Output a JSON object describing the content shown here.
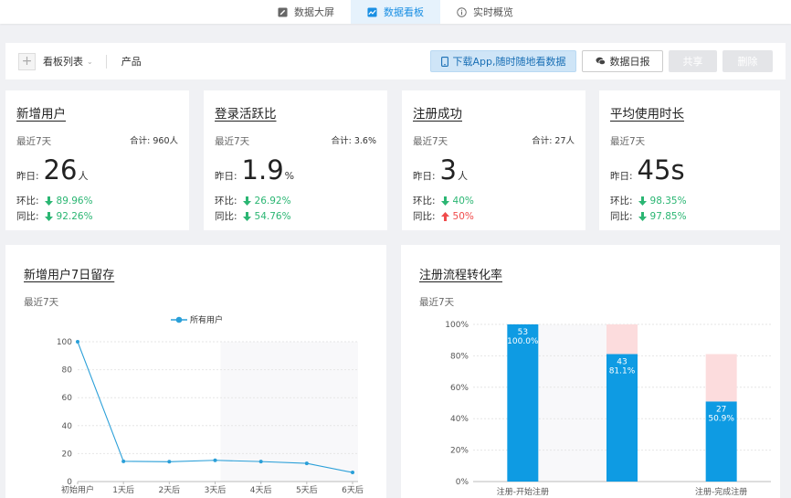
{
  "topnav": {
    "tabs": [
      {
        "label": "数据大屏",
        "icon": "edit-icon",
        "active": false
      },
      {
        "label": "数据看板",
        "icon": "line-chart-icon",
        "active": true
      },
      {
        "label": "实时概览",
        "icon": "info-icon",
        "active": false
      }
    ]
  },
  "toolbar": {
    "add_label": "+",
    "board_list_label": "看板列表",
    "board_name": "产品",
    "download_label": "下载App,随时随地看数据",
    "report_label": "数据日报",
    "share_label": "共享",
    "delete_label": "删除"
  },
  "stats": [
    {
      "title": "新增用户",
      "period": "最近7天",
      "total": "合计: 960人",
      "yesterday_label": "昨日:",
      "value": "26",
      "unit": "人",
      "hb_label": "环比:",
      "hb_value": "89.96%",
      "hb_dir": "down",
      "tb_label": "同比:",
      "tb_value": "92.26%",
      "tb_dir": "down"
    },
    {
      "title": "登录活跃比",
      "period": "最近7天",
      "total": "合计: 3.6%",
      "yesterday_label": "昨日:",
      "value": "1.9",
      "unit": "%",
      "hb_label": "环比:",
      "hb_value": "26.92%",
      "hb_dir": "down",
      "tb_label": "同比:",
      "tb_value": "54.76%",
      "tb_dir": "down"
    },
    {
      "title": "注册成功",
      "period": "最近7天",
      "total": "合计: 27人",
      "yesterday_label": "昨日:",
      "value": "3",
      "unit": "人",
      "hb_label": "环比:",
      "hb_value": "40%",
      "hb_dir": "down",
      "tb_label": "同比:",
      "tb_value": "50%",
      "tb_dir": "up"
    },
    {
      "title": "平均使用时长",
      "period": "最近7天",
      "total": "",
      "yesterday_label": "昨日:",
      "value": "45s",
      "unit": "",
      "hb_label": "环比:",
      "hb_value": "98.35%",
      "hb_dir": "down",
      "tb_label": "同比:",
      "tb_value": "97.85%",
      "tb_dir": "down"
    }
  ],
  "panels": {
    "retention": {
      "title": "新增用户7日留存",
      "period": "最近7天"
    },
    "funnel": {
      "title": "注册流程转化率",
      "period": "最近7天"
    }
  },
  "colors": {
    "accent": "#1a8fe3",
    "line": "#2a9fd8",
    "bar": "#0e9be3",
    "bar_loss": "#fcdcdd",
    "down": "#2bb673",
    "up": "#f04b4b"
  },
  "chart_data": [
    {
      "type": "line",
      "title": "新增用户7日留存",
      "x": [
        "初始用户",
        "1天后",
        "2天后",
        "3天后",
        "4天后",
        "5天后",
        "6天后"
      ],
      "series": [
        {
          "name": "所有用户",
          "values": [
            100,
            14.5,
            14.2,
            15.2,
            14.3,
            13.0,
            6.5
          ]
        }
      ],
      "ylim": [
        0,
        100
      ],
      "yticks": [
        0,
        20,
        40,
        60,
        80,
        100
      ],
      "grid": true,
      "legend": "top-center"
    },
    {
      "type": "bar",
      "title": "注册流程转化率",
      "categories": [
        "注册-开始注册",
        "",
        "注册-完成注册"
      ],
      "values": [
        100.0,
        81.1,
        50.9
      ],
      "counts": [
        53,
        43,
        27
      ],
      "loss_tops": [
        100.0,
        100.0,
        81.1
      ],
      "labels": [
        [
          "53",
          "100.0%"
        ],
        [
          "43",
          "81.1%"
        ],
        [
          "27",
          "50.9%"
        ]
      ],
      "ylim": [
        0,
        100
      ],
      "yticks": [
        "0%",
        "20%",
        "40%",
        "60%",
        "80%",
        "100%"
      ],
      "grid": true
    }
  ]
}
